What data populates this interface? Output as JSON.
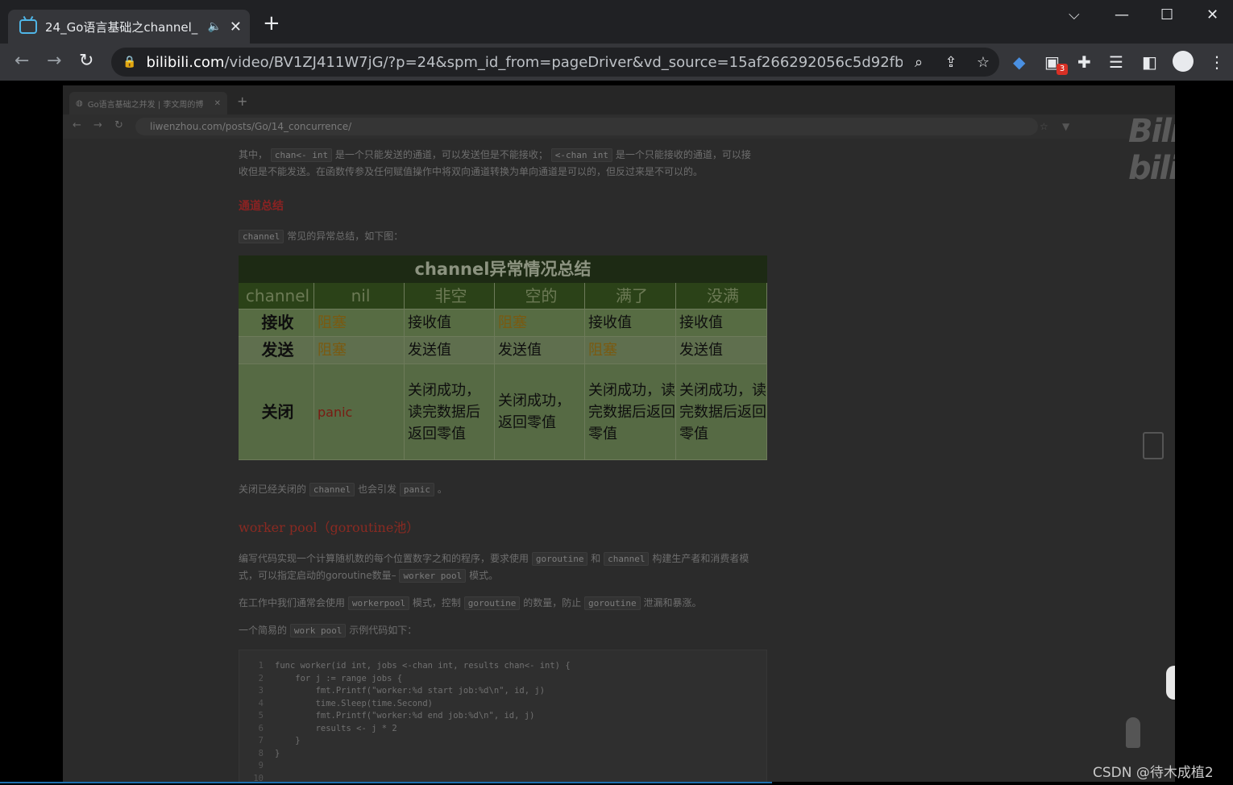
{
  "browser": {
    "tab_title": "24_Go语言基础之channel_",
    "url_host": "bilibili.com",
    "url_rest": "/video/BV1ZJ411W7jG/?p=24&spm_id_from=pageDriver&vd_source=15af266292056c5d92fb6aa4...",
    "ext_badge": "3",
    "accent": "#4fb5e6"
  },
  "inner_browser": {
    "tab_title": "Go语言基础之并发 | 李文周的博",
    "url": "liwenzhou.com/posts/Go/14_concurrence/"
  },
  "doc": {
    "para1_a": "其中，",
    "para1_code1": "chan<- int",
    "para1_b": "是一个只能发送的通道，可以发送但是不能接收；",
    "para1_code2": "<-chan int",
    "para1_c": "是一个只能接收的通道，可以接",
    "para1_line2": "收但是不能发送。在函数传参及任何赋值操作中将双向通道转换为单向通道是可以的，但反过来是不可以的。",
    "h_summary": "通道总结",
    "para2_code": "channel",
    "para2_text": "常见的异常总结，如下图：",
    "table": {
      "title": "channel异常情况总结",
      "headers": [
        "channel",
        "nil",
        "非空",
        "空的",
        "满了",
        "没满"
      ],
      "rows": [
        [
          "接收",
          "阻塞",
          "接收值",
          "阻塞",
          "接收值",
          "接收值"
        ],
        [
          "发送",
          "阻塞",
          "发送值",
          "发送值",
          "阻塞",
          "发送值"
        ],
        [
          "关闭",
          "panic",
          "关闭成功，读完数据后返回零值",
          "关闭成功，返回零值",
          "关闭成功，读完数据后返回零值",
          "关闭成功，读完数据后返回零值"
        ]
      ]
    },
    "para3_a": "关闭已经关闭的",
    "para3_code1": "channel",
    "para3_b": "也会引发",
    "para3_code2": "panic",
    "para3_c": "。",
    "h_worker": "worker pool（goroutine池）",
    "para4_a": "编写代码实现一个计算随机数的每个位置数字之和的程序，要求使用",
    "para4_code1": "goroutine",
    "para4_b": "和",
    "para4_code2": "channel",
    "para4_c": "构建生产者和消费者模",
    "para4_line2a": "式，可以指定启动的goroutine数量–",
    "para4_code3": "worker pool",
    "para4_line2b": "模式。",
    "para5_a": "在工作中我们通常会使用",
    "para5_code1": "workerpool",
    "para5_b": "模式，控制",
    "para5_code2": "goroutine",
    "para5_c": "的数量，防止",
    "para5_code3": "goroutine",
    "para5_d": "泄漏和暴涨。",
    "para6_a": "一个简易的",
    "para6_code": "work pool",
    "para6_b": "示例代码如下：",
    "code_lines": [
      "func worker(id int, jobs <-chan int, results chan<- int) {",
      "    for j := range jobs {",
      "        fmt.Printf(\"worker:%d start job:%d\\n\", id, j)",
      "        time.Sleep(time.Second)",
      "        fmt.Printf(\"worker:%d end job:%d\\n\", id, j)",
      "        results <- j * 2",
      "    }",
      "}",
      "",
      ""
    ]
  },
  "watermark": "CSDN @待木成植2",
  "site_logo": "Bilibili"
}
